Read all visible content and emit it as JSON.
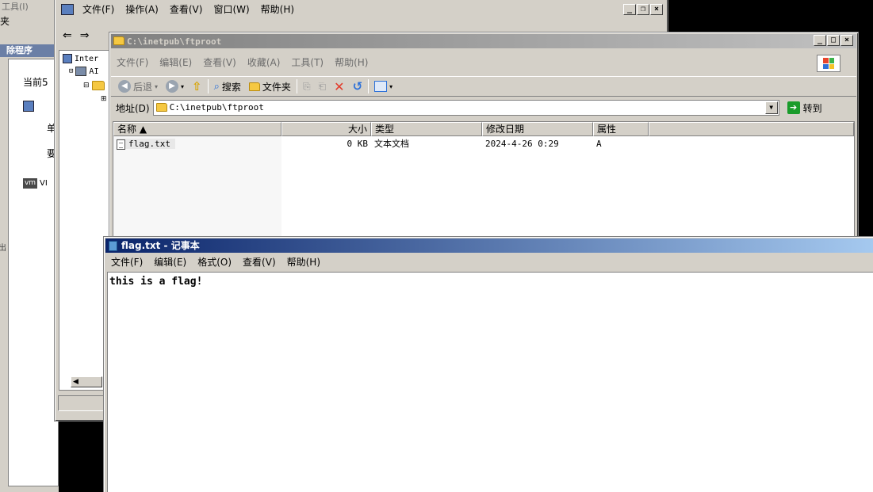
{
  "background_window": {
    "menu_fragment": "工具(I)",
    "toolbar_fragment": "夹",
    "section_label": "除程序",
    "current_label": "当前5",
    "item_fragments": [
      "单",
      "要"
    ],
    "vm_label": "VI",
    "side_mark": "出"
  },
  "iis_window": {
    "menu": [
      "文件(F)",
      "操作(A)",
      "查看(V)",
      "窗口(W)",
      "帮助(H)"
    ],
    "tree_items": [
      "Inter",
      "AI"
    ]
  },
  "explorer": {
    "title": "C:\\inetpub\\ftproot",
    "menu": [
      "文件(F)",
      "编辑(E)",
      "查看(V)",
      "收藏(A)",
      "工具(T)",
      "帮助(H)"
    ],
    "toolbar": {
      "back": "后退",
      "search": "搜索",
      "folders": "文件夹"
    },
    "address_label": "地址(D)",
    "address_value": "C:\\inetpub\\ftproot",
    "go_label": "转到",
    "columns": [
      "名称 ▲",
      "大小",
      "类型",
      "修改日期",
      "属性"
    ],
    "rows": [
      {
        "name": "flag.txt",
        "size": "0 KB",
        "type": "文本文档",
        "modified": "2024-4-26 0:29",
        "attr": "A"
      }
    ]
  },
  "notepad": {
    "title": "flag.txt - 记事本",
    "menu": [
      "文件(F)",
      "编辑(E)",
      "格式(O)",
      "查看(V)",
      "帮助(H)"
    ],
    "content": "this is a flag!"
  }
}
